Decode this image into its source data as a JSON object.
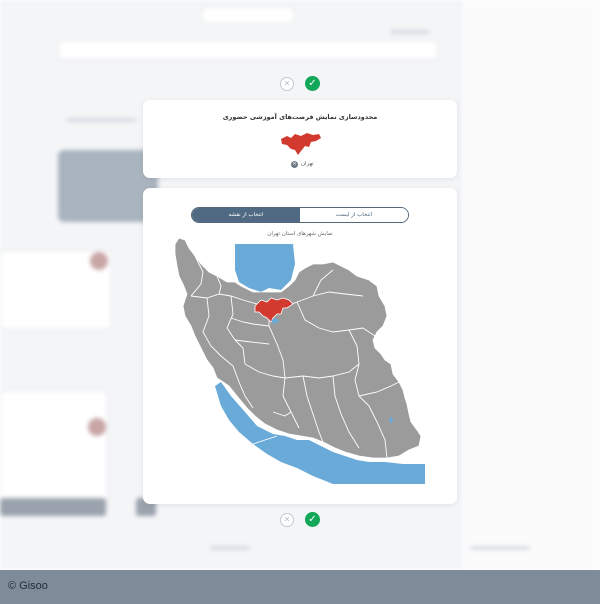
{
  "footer": {
    "copyright": "© Gisoo"
  },
  "location_card": {
    "title": "محدودسازی نمایش فرصت‌های آموزشی حضوری",
    "selected_province": "تهران",
    "remove_symbol": "×"
  },
  "map_card": {
    "tabs": [
      {
        "label": "انتخاب از لیست",
        "active": false
      },
      {
        "label": "انتخاب از نقشه",
        "active": true
      }
    ],
    "caption": "نمایش شهرهای استان تهران"
  },
  "icons": {
    "confirm": "check-icon",
    "cancel": "close-icon"
  },
  "colors": {
    "land": "#9b9b9b",
    "water": "#6aaad8",
    "selected": "#d23a2f",
    "tab_active": "#4f6a82",
    "confirm": "#12a85a"
  }
}
